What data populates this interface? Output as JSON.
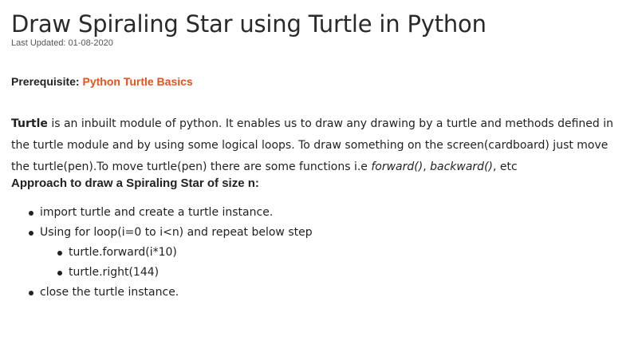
{
  "article": {
    "title": "Draw Spiraling Star using Turtle in Python",
    "last_updated": "Last Updated: 01-08-2020",
    "prerequisite_label": "Prerequisite: ",
    "prerequisite_link": "Python Turtle Basics",
    "link_color": "#e0541f",
    "intro": {
      "bold_word": "Turtle",
      "text_part1": " is an inbuilt module of python. It enables us to draw any drawing by a turtle and methods defined in the turtle module and by using some logical loops. To draw something on the screen(cardboard) just move the turtle(pen).To move turtle(pen) there are some functions i.e ",
      "func1": "forward()",
      "sep": ", ",
      "func2": "backward()",
      "text_end": ", etc"
    },
    "approach_heading": "Approach to draw a Spiraling Star of size n:",
    "steps": [
      "import turtle and create a turtle instance.",
      "Using for loop(i=0 to i<n) and repeat below step",
      "close the turtle instance."
    ],
    "sub_steps": [
      "turtle.forward(i*10)",
      "turtle.right(144)"
    ]
  }
}
